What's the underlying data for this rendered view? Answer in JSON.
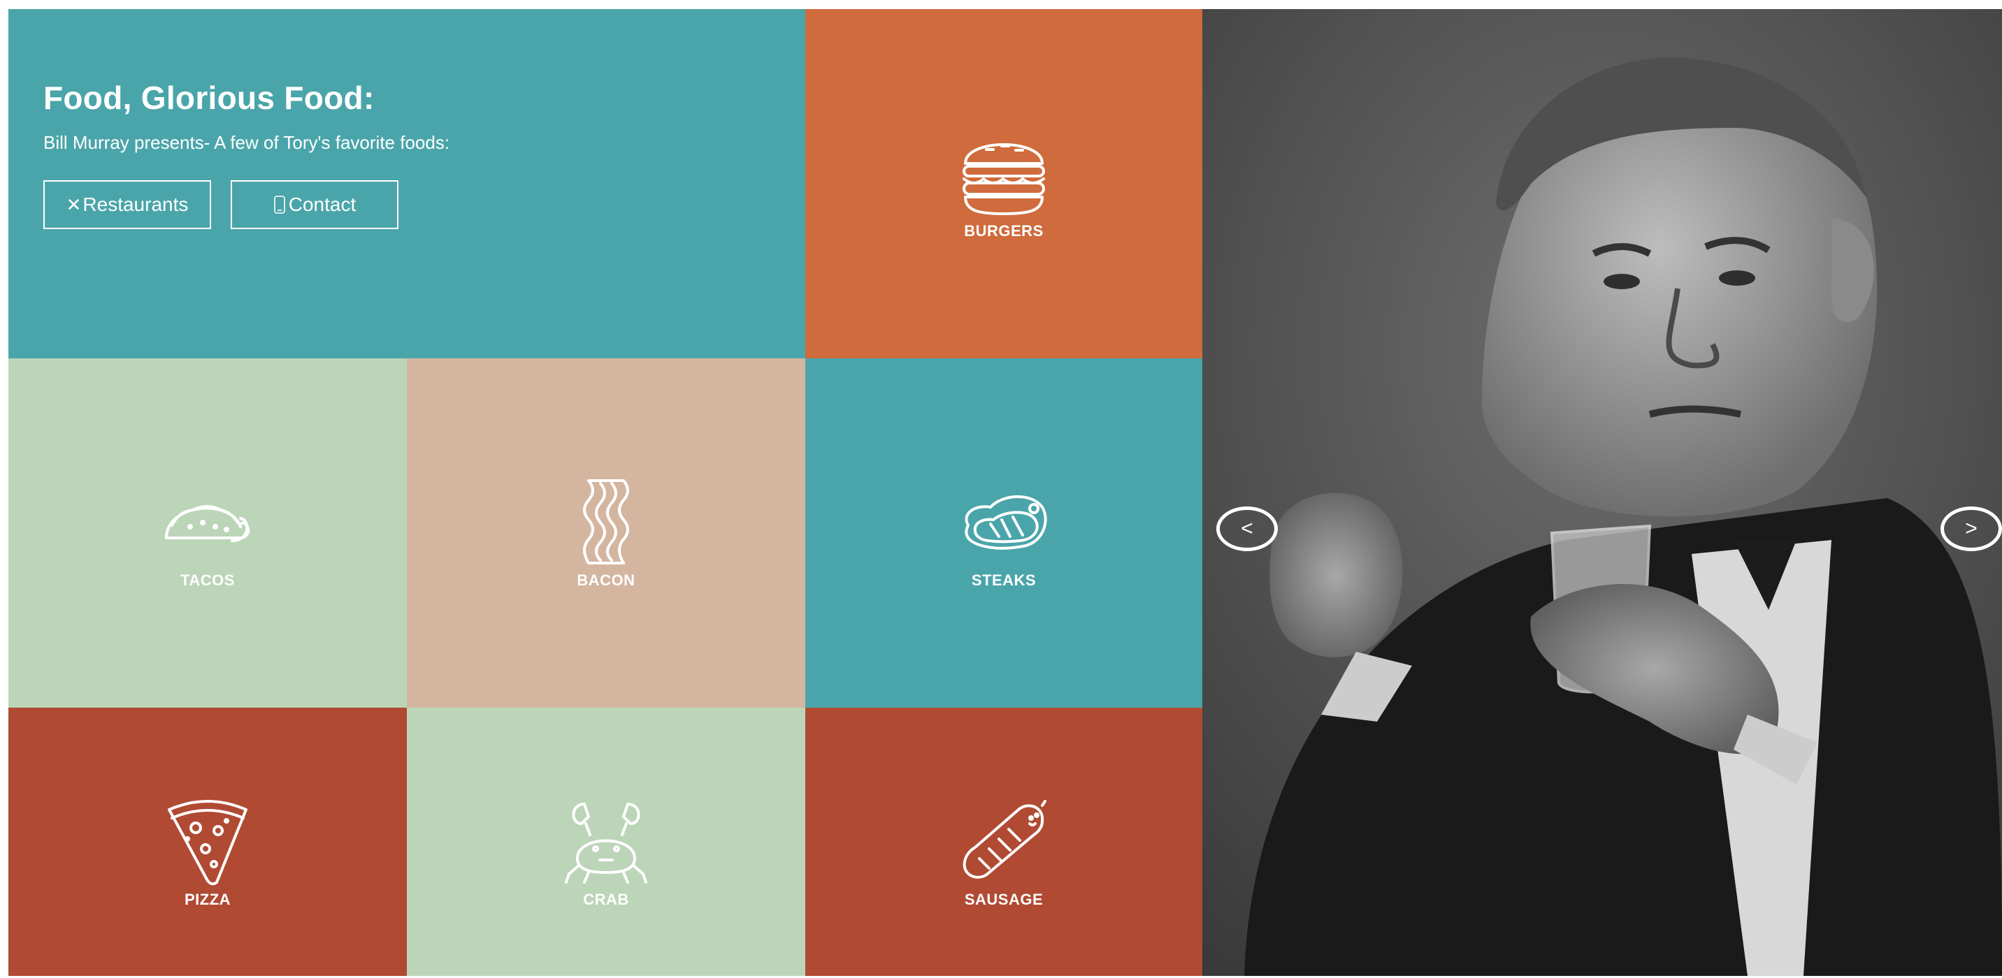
{
  "hero": {
    "title": "Food, Glorious Food:",
    "subtitle": "Bill Murray presents- A few of Tory's favorite foods:",
    "buttons": [
      {
        "label": "Restaurants",
        "icon": "fork-knife-icon"
      },
      {
        "label": "Contact",
        "icon": "phone-icon"
      }
    ]
  },
  "tiles": [
    {
      "label": "BURGERS",
      "icon": "burger-icon",
      "color": "#cf6b3c"
    },
    {
      "label": "TACOS",
      "icon": "taco-icon",
      "color": "#bcd5b8"
    },
    {
      "label": "BACON",
      "icon": "bacon-icon",
      "color": "#d4b5a0"
    },
    {
      "label": "STEAKS",
      "icon": "steak-icon",
      "color": "#4aa5aa"
    },
    {
      "label": "PIZZA",
      "icon": "pizza-icon",
      "color": "#b04a33"
    },
    {
      "label": "CRAB",
      "icon": "crab-icon",
      "color": "#bcd5b8"
    },
    {
      "label": "SAUSAGE",
      "icon": "sausage-icon",
      "color": "#b04a33"
    }
  ],
  "carousel": {
    "prev_label": "<",
    "next_label": ">",
    "image": "bill-murray-portrait"
  },
  "colors": {
    "teal": "#4aa5aa",
    "orange": "#cf6b3c",
    "sage": "#bcd5b8",
    "tan": "#d4b5a0",
    "rust": "#b04a33"
  }
}
